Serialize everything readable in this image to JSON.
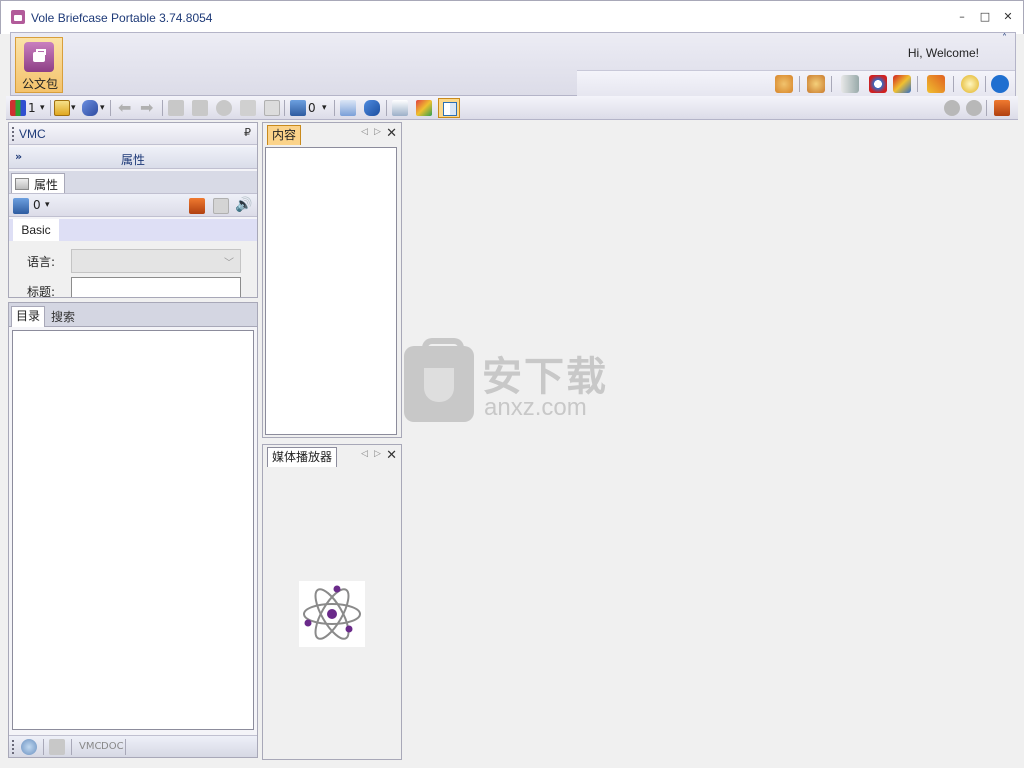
{
  "window": {
    "title": "Vole Briefcase Portable  3.74.8054",
    "minimize": "–",
    "maximize": "□",
    "close": "✕"
  },
  "ribbon": {
    "main_button_label": "公文包",
    "welcome": "Hi, Welcome!",
    "collapse": "˄"
  },
  "toolbar": {
    "count1": "1",
    "count2": "0",
    "dropdown": "▾"
  },
  "vmc_panel": {
    "title": "VMC",
    "pin": "₽",
    "section_title": "属性",
    "chevron": "»",
    "tab_label": "属性",
    "counter": "0",
    "basic_tab": "Basic",
    "fields": {
      "language_label": "语言:",
      "title_label": "标题:"
    }
  },
  "nav_panel": {
    "tab_catalog": "目录",
    "tab_search": "搜索",
    "footer_vmc": "VMC",
    "footer_doc": "DOC"
  },
  "content_panel": {
    "tab_label": "内容",
    "nav_prev": "◁",
    "nav_next": "▷",
    "close": "✕"
  },
  "media_panel": {
    "tab_label": "媒体播放器",
    "nav_prev": "◁",
    "nav_next": "▷",
    "close": "✕"
  },
  "watermark": {
    "line1": "安下载",
    "line2": "anxz.com"
  }
}
